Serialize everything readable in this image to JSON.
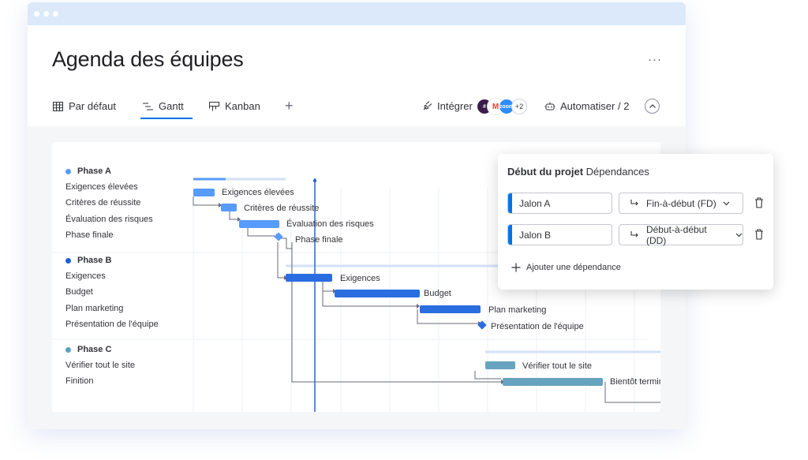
{
  "page": {
    "title": "Agenda des équipes",
    "more_label": "···"
  },
  "tabs": [
    {
      "label": "Par défaut",
      "icon": "table-icon"
    },
    {
      "label": "Gantt",
      "icon": "gantt-icon"
    },
    {
      "label": "Kanban",
      "icon": "kanban-icon"
    }
  ],
  "add_tab_label": "+",
  "toolbar": {
    "integrate_label": "Intégrer",
    "integration_more": "+2",
    "automate_label": "Automatiser / 2"
  },
  "colors": {
    "accent": "#0073ea",
    "phase_a": "#579bfc",
    "phase_b": "#2a6de0",
    "phase_c": "#66a3bf",
    "today_line": "#2a67d6"
  },
  "groups": [
    {
      "name": "Phase A",
      "items": [
        "Exigences élevées",
        "Critères de réussite",
        "Évaluation des risques",
        "Phase finale"
      ]
    },
    {
      "name": "Phase B",
      "items": [
        "Exigences",
        "Budget",
        "Plan marketing",
        "Présentation de l'équipe"
      ]
    },
    {
      "name": "Phase C",
      "items": [
        "Vérifier tout le site",
        "Finition"
      ]
    }
  ],
  "bar_labels": [
    "Exigences élevées",
    "Critères de réussite",
    "Évaluation des risques",
    "Phase finale",
    "Exigences",
    "Budget",
    "Plan marketing",
    "Présentation de l'équipe",
    "Vérifier tout le site",
    "Bientôt terminé"
  ],
  "dependencies_panel": {
    "title_bold": "Début du projet",
    "title_rest": "Dépendances",
    "rows": [
      {
        "milestone": "Jalon A",
        "type": "Fin-à-début (FD)"
      },
      {
        "milestone": "Jalon B",
        "type": "Début-à-début (DD)"
      }
    ],
    "add_label": "Ajouter une dépendance"
  }
}
